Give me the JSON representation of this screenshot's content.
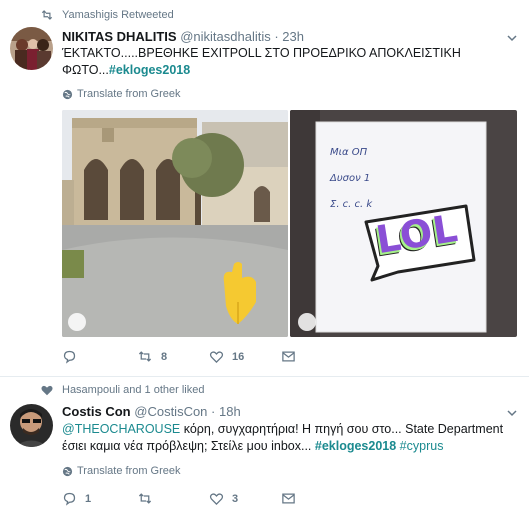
{
  "tweet1": {
    "context": "Yamashigis Retweeted",
    "name": "NIKITAS DHALITIS",
    "handle": "@nikitasdhalitis",
    "time": "· 23h",
    "text_line1": "ΈΚΤΑΚΤΟ.....ΒΡΕΘΗΚΕ  EXITPOLL ΣΤΟ ΠΡΟΕΔΡΙΚΟ  ΑΠΟΚΛΕΙΣΤΙΚΗ",
    "text_line2": "ΦΩΤΟ...",
    "hashtag": "#ekloges2018",
    "translate": "Translate from Greek",
    "sticker": "LOL",
    "paper_line1": "Μια ΟΠ",
    "paper_line2": "Δυσον 1",
    "paper_line3": "Σ. c. c. k",
    "replies": "",
    "retweets": "8",
    "likes": "16"
  },
  "tweet2": {
    "context": "Hasampouli and 1 other liked",
    "name": "Costis Con",
    "handle": "@CostisCon",
    "time": "· 18h",
    "mention": "@THEOCHAROUSE",
    "text_part1": " κόρη, συγχαρητήρια! Η πηγή σου στο... State Department",
    "text_part2": "έσιει καμια νέα πρόβλεψη; Στείλε μου inbox... ",
    "hashtag": "#ekloges2018",
    "hashtag2": "#cyprus",
    "translate": "Translate from Greek",
    "replies": "1",
    "retweets": "",
    "likes": "3"
  },
  "colors": {
    "accent": "#1b8a8f",
    "muted": "#657786",
    "sticker_purple": "#8a4fd6",
    "sticker_green": "#a6f28a"
  }
}
